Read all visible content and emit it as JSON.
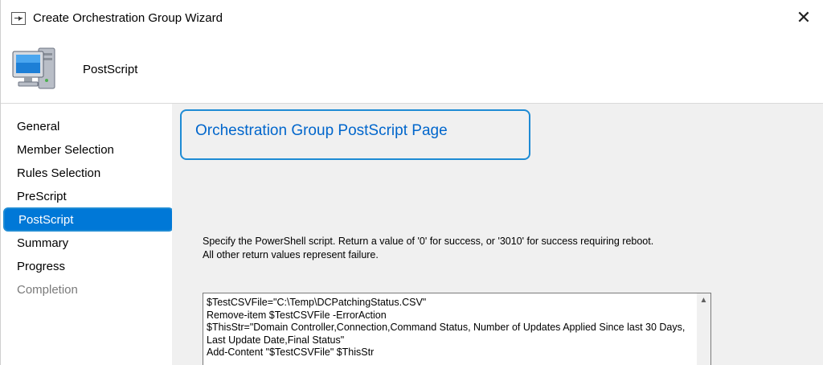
{
  "window": {
    "title": "Create Orchestration Group Wizard",
    "close_symbol": "✕"
  },
  "header": {
    "title": "PostScript",
    "icon": "computer-icon"
  },
  "nav": {
    "items": [
      {
        "label": "General",
        "state": "normal"
      },
      {
        "label": "Member Selection",
        "state": "normal"
      },
      {
        "label": "Rules Selection",
        "state": "normal"
      },
      {
        "label": "PreScript",
        "state": "normal"
      },
      {
        "label": "PostScript",
        "state": "selected"
      },
      {
        "label": "Summary",
        "state": "normal"
      },
      {
        "label": "Progress",
        "state": "normal"
      },
      {
        "label": "Completion",
        "state": "disabled"
      }
    ]
  },
  "page": {
    "heading": "Orchestration Group PostScript Page",
    "instruction_line1": "Specify the PowerShell script. Return a value of '0' for success, or '3010' for success requiring reboot.",
    "instruction_line2": "All other return values represent failure.",
    "script": "$TestCSVFile=\"C:\\Temp\\DCPatchingStatus.CSV\"\nRemove-item $TestCSVFile -ErrorAction\n$ThisStr=\"Domain Controller,Connection,Command Status, Number of Updates Applied Since last 30 Days, Last Update Date,Final Status\"\nAdd-Content \"$TestCSVFile\" $ThisStr"
  },
  "colors": {
    "selected_bg": "#0078d7",
    "highlight_border": "#1e8bd4",
    "heading_text": "#0066cc",
    "content_bg": "#f0f0f0"
  }
}
